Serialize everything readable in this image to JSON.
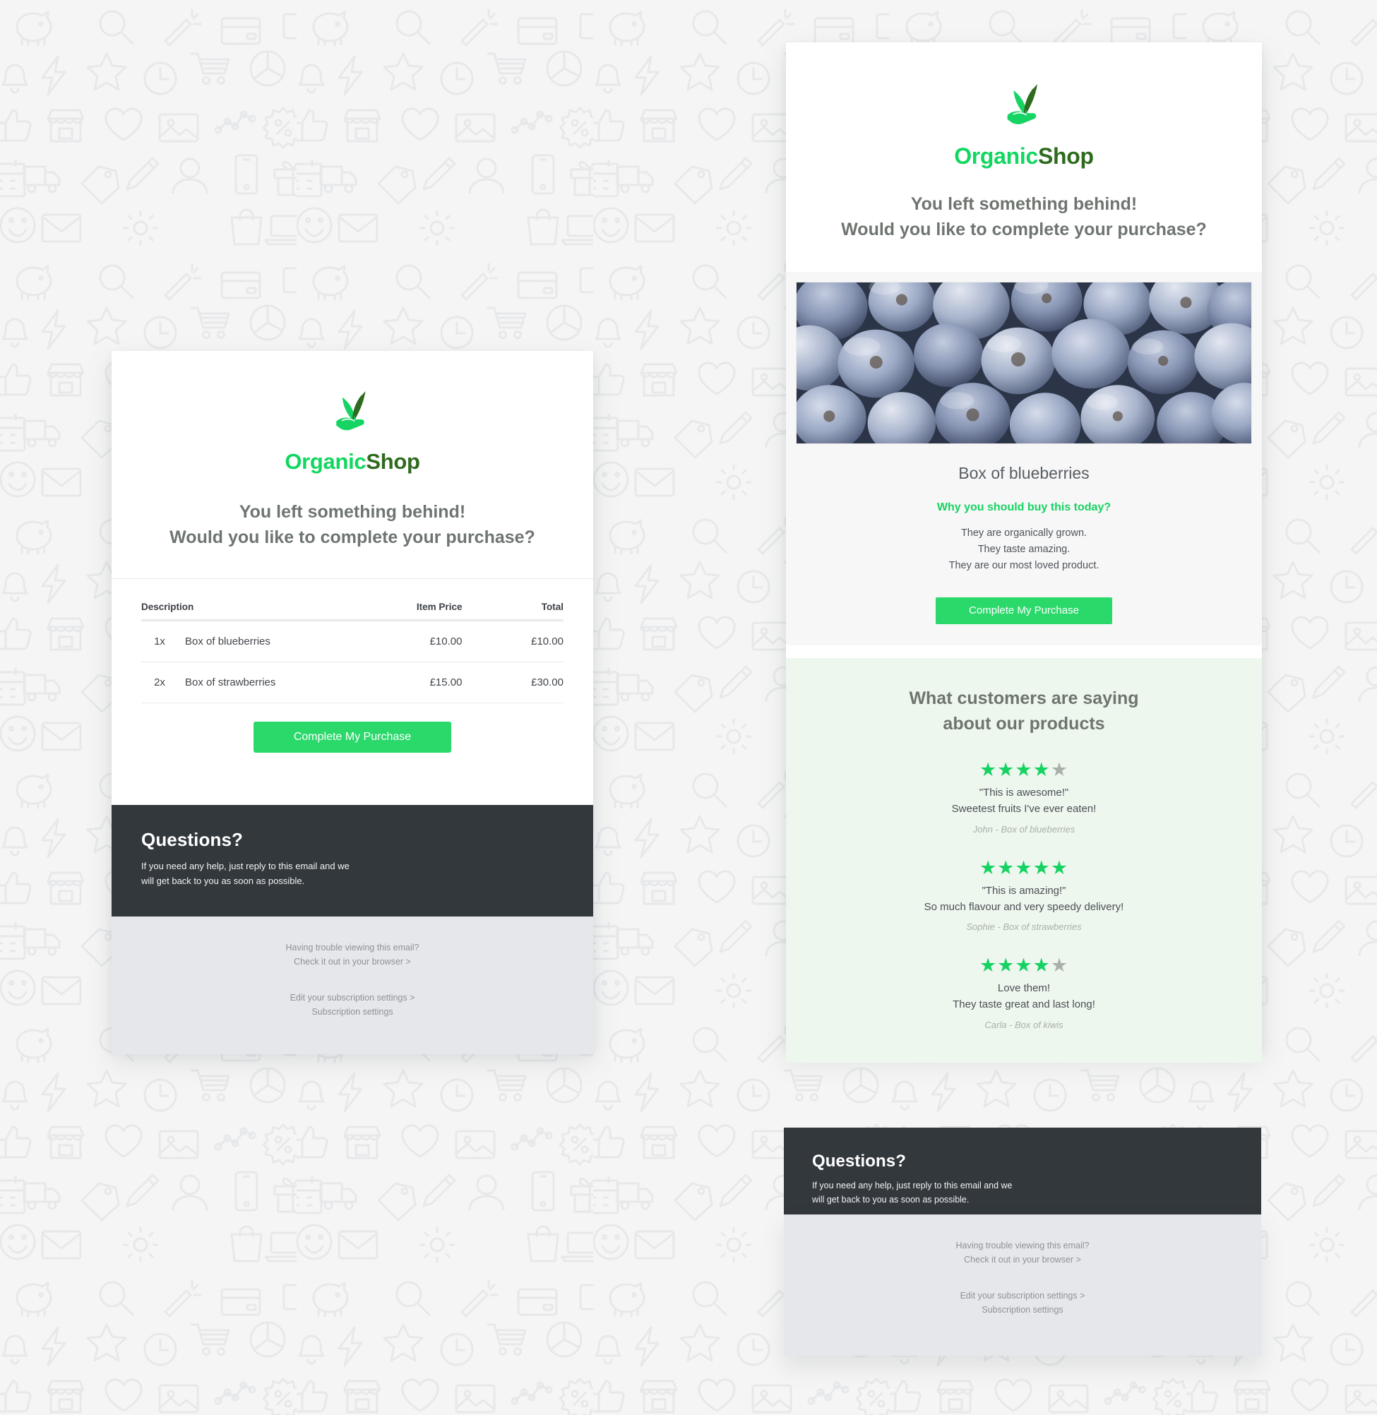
{
  "brand": {
    "name_part1": "Organic",
    "name_part2": "Shop",
    "logo_icon": "plant-in-hand-icon",
    "green_bright": "#11d760",
    "green_dark": "#2e6b1e",
    "cta_green": "#2bd96b",
    "accent_green": "#16d362",
    "dark_band": "#33383d",
    "gray_footer": "#e5e7ea",
    "reviews_bg": "#edf7ee"
  },
  "headline": {
    "line1": "You left something behind!",
    "line2": "Would you like to complete your purchase?"
  },
  "order_table": {
    "headers": {
      "description": "Description",
      "item_price": "Item Price",
      "total": "Total"
    },
    "rows": [
      {
        "qty": "1x",
        "name": "Box of blueberries",
        "price": "£10.00",
        "total": "£10.00"
      },
      {
        "qty": "2x",
        "name": "Box of strawberries",
        "price": "£15.00",
        "total": "£30.00"
      }
    ]
  },
  "cta": {
    "label": "Complete My Purchase"
  },
  "product": {
    "image_alt": "blueberries-photo",
    "name": "Box of blueberries",
    "subhead": "Why you should buy this today?",
    "bullets": [
      "They are organically grown.",
      "They taste amazing.",
      "They are our most loved product."
    ]
  },
  "reviews": {
    "title_line1": "What customers are saying",
    "title_line2": "about our products",
    "items": [
      {
        "rating": 4,
        "max_rating": 5,
        "line1": "\"This is awesome!\"",
        "line2": "Sweetest fruits I've ever eaten!",
        "author": "John - Box of blueberries"
      },
      {
        "rating": 5,
        "max_rating": 5,
        "line1": "\"This is amazing!\"",
        "line2": "So much flavour and very speedy delivery!",
        "author": "Sophie - Box of strawberries"
      },
      {
        "rating": 4,
        "max_rating": 5,
        "line1": "Love them!",
        "line2": "They taste great and last long!",
        "author": "Carla - Box of kiwis"
      }
    ]
  },
  "questions": {
    "title": "Questions?",
    "body_line1": "If you need any help, just reply to this email and we",
    "body_line2": "will get back to you as soon as possible."
  },
  "footer": {
    "trouble_line1": "Having trouble viewing this email?",
    "trouble_line2": "Check it out in your browser >",
    "subscription_line1": "Edit your subscription settings >",
    "subscription_line2": "Subscription settings"
  }
}
